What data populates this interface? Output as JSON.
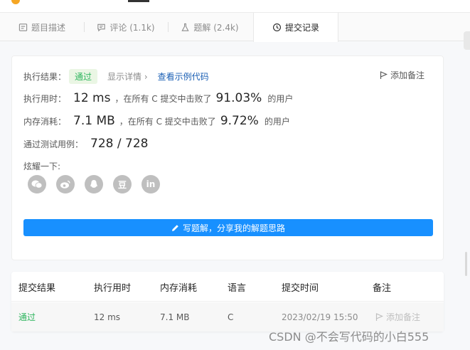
{
  "tabs": [
    {
      "label": "题目描述",
      "icon": "description-icon"
    },
    {
      "label": "评论 (1.1k)",
      "icon": "comment-icon"
    },
    {
      "label": "题解 (2.4k)",
      "icon": "flask-icon"
    },
    {
      "label": "提交记录",
      "icon": "clock-icon",
      "active": true
    }
  ],
  "result": {
    "label": "执行结果：",
    "status": "通过",
    "details": "显示详情 ›",
    "example": "查看示例代码",
    "add_note": "添加备注"
  },
  "runtime": {
    "label": "执行用时：",
    "value": "12 ms",
    "mid": "，在所有 C 提交中击败了",
    "pct": "91.03%",
    "suffix": "的用户"
  },
  "memory": {
    "label": "内存消耗：",
    "value": "7.1 MB",
    "mid": "，在所有 C 提交中击败了",
    "pct": "9.72%",
    "suffix": "的用户"
  },
  "tests": {
    "label": "通过测试用例：",
    "value": "728 / 728"
  },
  "share": {
    "label": "炫耀一下:",
    "icons": [
      "wechat-icon",
      "weibo-icon",
      "qq-icon",
      "douban-icon",
      "linkedin-icon"
    ],
    "glyphs": [
      "",
      "",
      "",
      "豆",
      "in"
    ]
  },
  "write_button": "写题解，分享我的解题思路",
  "table": {
    "headers": [
      "提交结果",
      "执行用时",
      "内存消耗",
      "语言",
      "提交时间",
      "备注"
    ],
    "row": {
      "status": "通过",
      "runtime": "12 ms",
      "memory": "7.1 MB",
      "language": "C",
      "time": "2023/02/19 15:50",
      "note": "添加备注"
    }
  },
  "watermark": "CSDN @不会写代码的小白555",
  "colors": {
    "accent": "#1890ff",
    "success": "#2db55d",
    "link": "#1a5fb4"
  }
}
